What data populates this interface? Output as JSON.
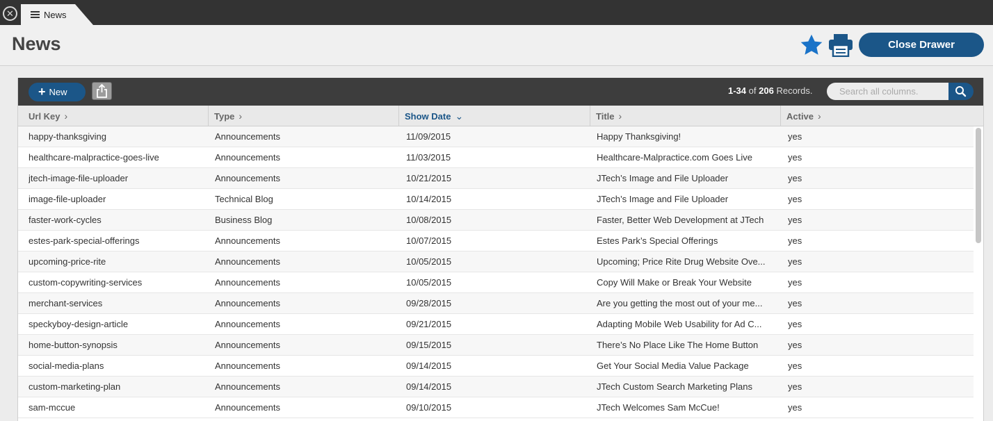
{
  "tab": {
    "label": "News",
    "close_icon": "close-icon",
    "menu_icon": "menu-icon"
  },
  "header": {
    "title": "News",
    "close_drawer_label": "Close Drawer",
    "accent_color": "#1b5688",
    "star_color": "#1a73c8"
  },
  "toolbar": {
    "new_label": "New",
    "records_range": "1-34",
    "records_of": "of",
    "records_total": "206",
    "records_suffix": "Records.",
    "search_placeholder": "Search all columns."
  },
  "columns": [
    {
      "label": "Url Key",
      "chevron": "›"
    },
    {
      "label": "Type",
      "chevron": "›"
    },
    {
      "label": "Show Date",
      "chevron": "⌄",
      "sorted": true
    },
    {
      "label": "Title",
      "chevron": "›"
    },
    {
      "label": "Active",
      "chevron": "›"
    }
  ],
  "rows": [
    [
      "happy-thanksgiving",
      "Announcements",
      "11/09/2015",
      "Happy Thanksgiving!",
      "yes"
    ],
    [
      "healthcare-malpractice-goes-live",
      "Announcements",
      "11/03/2015",
      "Healthcare-Malpractice.com Goes Live",
      "yes"
    ],
    [
      "jtech-image-file-uploader",
      "Announcements",
      "10/21/2015",
      "JTech’s Image and File Uploader",
      "yes"
    ],
    [
      "image-file-uploader",
      "Technical Blog",
      "10/14/2015",
      "JTech’s Image and File Uploader",
      "yes"
    ],
    [
      "faster-work-cycles",
      "Business Blog",
      "10/08/2015",
      "Faster, Better Web Development at JTech",
      "yes"
    ],
    [
      "estes-park-special-offerings",
      "Announcements",
      "10/07/2015",
      "Estes Park’s Special Offerings",
      "yes"
    ],
    [
      "upcoming-price-rite",
      "Announcements",
      "10/05/2015",
      "Upcoming; Price Rite Drug Website Ove...",
      "yes"
    ],
    [
      "custom-copywriting-services",
      "Announcements",
      "10/05/2015",
      "Copy Will Make or Break Your Website",
      "yes"
    ],
    [
      "merchant-services",
      "Announcements",
      "09/28/2015",
      "Are you getting the most out of your me...",
      "yes"
    ],
    [
      "speckyboy-design-article",
      "Announcements",
      "09/21/2015",
      "Adapting Mobile Web Usability for Ad C...",
      "yes"
    ],
    [
      "home-button-synopsis",
      "Announcements",
      "09/15/2015",
      "There’s No Place Like The Home Button",
      "yes"
    ],
    [
      "social-media-plans",
      "Announcements",
      "09/14/2015",
      "Get Your Social Media Value Package",
      "yes"
    ],
    [
      "custom-marketing-plan",
      "Announcements",
      "09/14/2015",
      "JTech Custom Search Marketing Plans",
      "yes"
    ],
    [
      "sam-mccue",
      "Announcements",
      "09/10/2015",
      "JTech Welcomes Sam McCue!",
      "yes"
    ]
  ]
}
